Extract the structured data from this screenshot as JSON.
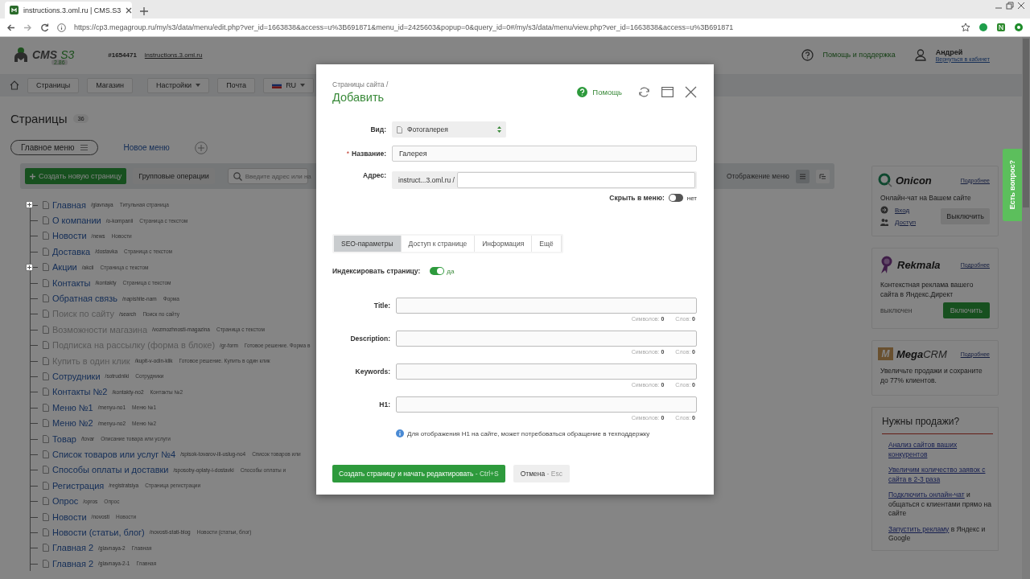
{
  "browser": {
    "tab_title": "instructions.3.oml.ru | CMS.S3",
    "url": "https://cp3.megagroup.ru/my/s3/data/menu/edit.php?ver_id=1663838&access=u%3B691871&menu_id=2425603&popup=0&query_id=0#/my/s3/data/menu/view.php?ver_id=1663838&access=u%3B691871"
  },
  "header": {
    "logo": {
      "name": "CMS",
      "suffix": "S3",
      "version": "2.86"
    },
    "site_id": "#1654471",
    "site_link": "instructions.3.oml.ru",
    "help": "Помощь и поддержка",
    "user": {
      "name": "Андрей",
      "link": "Вернуться в кабинет"
    }
  },
  "nav": [
    {
      "label": "Страницы",
      "dropdown": false
    },
    {
      "label": "Магазин",
      "dropdown": false
    },
    {
      "label": "Настройки",
      "dropdown": true
    },
    {
      "label": "Почта",
      "dropdown": false
    }
  ],
  "language": {
    "code": "RU",
    "dropdown": true
  },
  "page": {
    "title": "Страницы",
    "count": "36"
  },
  "menus": [
    {
      "label": "Главное меню",
      "selected": true
    },
    {
      "label": "Новое меню",
      "selected": false
    }
  ],
  "toolbar": {
    "create": "Создать новую страницу",
    "group": "Групповые операции",
    "search_placeholder": "Введите адрес или на",
    "view_label": "Отображение меню",
    "views": [
      {
        "kind": "list",
        "selected": true
      },
      {
        "kind": "tree",
        "selected": false
      }
    ]
  },
  "pages": [
    {
      "title": "Главная",
      "path": "/glavnaya",
      "type": "Титульная страница",
      "disabled": false,
      "expandable": true
    },
    {
      "title": "О компании",
      "path": "/o-kompanii",
      "type": "Страница с текстом",
      "disabled": false,
      "expandable": false
    },
    {
      "title": "Новости",
      "path": "/news",
      "type": "Новости",
      "disabled": false,
      "expandable": false
    },
    {
      "title": "Доставка",
      "path": "/dostavka",
      "type": "Страница с текстом",
      "disabled": false,
      "expandable": false
    },
    {
      "title": "Акции",
      "path": "/akcii",
      "type": "Страница с текстом",
      "disabled": false,
      "expandable": true
    },
    {
      "title": "Контакты",
      "path": "/kontakty",
      "type": "Страница с текстом",
      "disabled": false,
      "expandable": false
    },
    {
      "title": "Обратная связь",
      "path": "/napishite-nam",
      "type": "Форма",
      "disabled": false,
      "expandable": false
    },
    {
      "title": "Поиск по сайту",
      "path": "/search",
      "type": "Поиск по сайту",
      "disabled": true,
      "expandable": false
    },
    {
      "title": "Возможности магазина",
      "path": "/vozmozhnosti-magazina",
      "type": "Страница с текстом",
      "disabled": true,
      "expandable": false
    },
    {
      "title": "Подписка на рассылку (форма в блоке)",
      "path": "/gr-form",
      "type": "Готовое решение. Форма в",
      "disabled": true,
      "expandable": false
    },
    {
      "title": "Купить в один клик",
      "path": "/kupit-v-odin-klik",
      "type": "Готовое решение. Купить в один клик",
      "disabled": true,
      "expandable": false
    },
    {
      "title": "Сотрудники",
      "path": "/sotrudniki",
      "type": "Сотрудники",
      "disabled": false,
      "expandable": false
    },
    {
      "title": "Контакты №2",
      "path": "/kontakty-no2",
      "type": "Контакты №2",
      "disabled": false,
      "expandable": false
    },
    {
      "title": "Меню №1",
      "path": "/menyu-no1",
      "type": "Меню №1",
      "disabled": false,
      "expandable": false
    },
    {
      "title": "Меню №2",
      "path": "/menyu-no2",
      "type": "Меню №2",
      "disabled": false,
      "expandable": false
    },
    {
      "title": "Товар",
      "path": "/tovar",
      "type": "Описание товара или услуги",
      "disabled": false,
      "expandable": false
    },
    {
      "title": "Список товаров или услуг №4",
      "path": "/spisok-tovarov-ili-uslug-no4",
      "type": "Список товаров или",
      "disabled": false,
      "expandable": false
    },
    {
      "title": "Способы оплаты и доставки",
      "path": "/sposoby-oplaty-i-dostavki",
      "type": "Способы оплаты и",
      "disabled": false,
      "expandable": false
    },
    {
      "title": "Регистрация",
      "path": "/registratsiya",
      "type": "Страница регистрации",
      "disabled": false,
      "expandable": false
    },
    {
      "title": "Опрос",
      "path": "/opros",
      "type": "Опрос",
      "disabled": false,
      "expandable": false
    },
    {
      "title": "Новости",
      "path": "/novosti",
      "type": "Новости",
      "disabled": false,
      "expandable": false
    },
    {
      "title": "Новости (статьи, блог)",
      "path": "/novosti-stati-blog",
      "type": "Новости (статьи, блог)",
      "disabled": false,
      "expandable": false
    },
    {
      "title": "Главная 2",
      "path": "/glavnaya-2",
      "type": "Главная",
      "disabled": false,
      "expandable": false
    },
    {
      "title": "Главная 2",
      "path": "/glavnaya-2-1",
      "type": "Главная",
      "disabled": false,
      "expandable": false
    }
  ],
  "sidebar": {
    "onicon": {
      "name": "Onicon",
      "more": "Подробнее",
      "text": "Онлайн-чат на Вашем сайте",
      "links": [
        {
          "kind": "login",
          "label": "Вход"
        },
        {
          "kind": "access",
          "label": "Доступ"
        }
      ],
      "button": "Выключить"
    },
    "rekmala": {
      "name": "Rekmala",
      "more": "Подробнее",
      "text": "Контекстная реклама вашего сайта в Яндекс.Директ",
      "status": "выключен",
      "button": "Включить"
    },
    "megacrm": {
      "mark": "M",
      "name": "Mega",
      "name_suffix": "CRM",
      "more": "Подробнее",
      "text": "Увеличьте продажи и сохраните до 77% клиентов."
    },
    "sales": {
      "title": "Нужны продажи?",
      "items": [
        {
          "link": "Анализ сайтов ваших конкурентов"
        },
        {
          "link": "Увеличим количество заявок с сайта в 2-3 раза"
        },
        {
          "link": "Подключить онлайн-чат",
          "text": " и общаться с клиентами прямо на сайте"
        },
        {
          "link": "Запустить рекламу",
          "text": " в Яндекс и Google"
        }
      ]
    }
  },
  "help_tab": "Есть вопрос?",
  "modal": {
    "breadcrumb": "Страницы сайта /",
    "title": "Добавить",
    "help": "Помощь",
    "type": {
      "label": "Вид:",
      "value": "Фотогалерея"
    },
    "name": {
      "label": "Название:",
      "required_mark": "*",
      "value": "Галерея"
    },
    "address": {
      "label": "Адрес:",
      "prefix": "instruct...3.oml.ru /"
    },
    "hide": {
      "label": "Скрыть в меню:",
      "on": false,
      "state": "нет"
    },
    "tabs": [
      {
        "label": "SEO-параметры",
        "selected": true
      },
      {
        "label": "Доступ к странице",
        "selected": false
      },
      {
        "label": "Информация",
        "selected": false
      },
      {
        "label": "Ещё",
        "selected": false
      }
    ],
    "index": {
      "label": "Индексировать страницу:",
      "on": true,
      "state": "да"
    },
    "seo_fields": [
      {
        "label": "Title:",
        "chars_label": "Символов:",
        "chars": "0",
        "words_label": "Слов:",
        "words": "0"
      },
      {
        "label": "Description:",
        "chars_label": "Символов:",
        "chars": "0",
        "words_label": "Слов:",
        "words": "0"
      },
      {
        "label": "Keywords:",
        "chars_label": "Символов:",
        "chars": "0",
        "words_label": "Слов:",
        "words": "0"
      },
      {
        "label": "H1:",
        "chars_label": "Символов:",
        "chars": "0",
        "words_label": "Слов:",
        "words": "0"
      }
    ],
    "note": "Для отображения H1 на сайте, может потребоваться обращение в техподдержку",
    "submit": {
      "label": "Создать страницу и начать редактировать",
      "hint": "- Ctrl+S"
    },
    "cancel": {
      "label": "Отмена",
      "hint": "- Esc"
    }
  }
}
